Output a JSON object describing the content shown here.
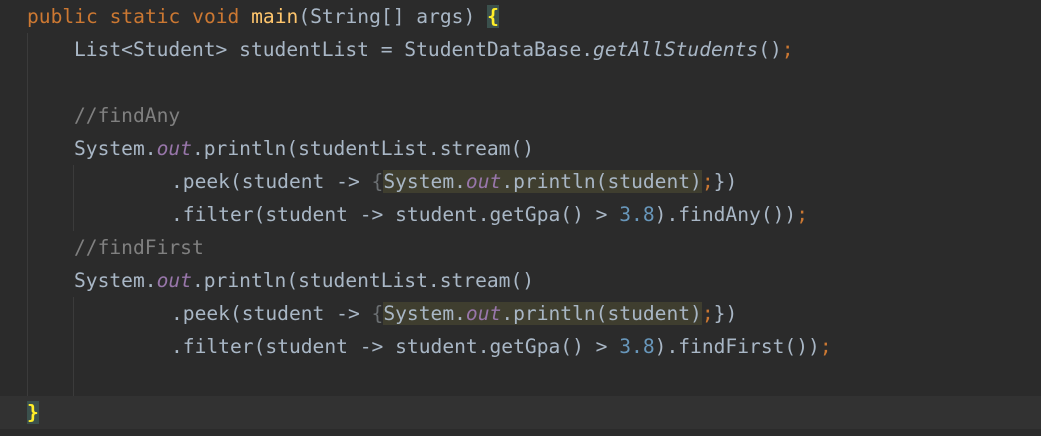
{
  "code": {
    "line1": {
      "kw_public": "public",
      "sp1": " ",
      "kw_static": "static",
      "sp2": " ",
      "kw_void": "void",
      "sp3": " ",
      "method": "main",
      "params": "(String[] args) ",
      "brace_open": "{"
    },
    "line2": {
      "pre": "List<Student> studentList = StudentDataBase.",
      "call": "getAllStudents",
      "post": "()",
      "semi": ";"
    },
    "line4": {
      "comment": "//findAny"
    },
    "line5": {
      "pre": "System.",
      "field": "out",
      "post": ".println(studentList.stream()"
    },
    "line6": {
      "pre": ".peek(student -> ",
      "brace_open": "{",
      "hl_pre": "System.",
      "hl_field": "out",
      "hl_post": ".println(student)",
      "semi": ";",
      "close": "})"
    },
    "line7": {
      "pre": ".filter(student -> student.getGpa() > ",
      "num": "3.8",
      "post": ").findAny())",
      "semi": ";"
    },
    "line8": {
      "comment": "//findFirst"
    },
    "line9": {
      "pre": "System.",
      "field": "out",
      "post": ".println(studentList.stream()"
    },
    "line10": {
      "pre": ".peek(student -> ",
      "brace_open": "{",
      "hl_pre": "System.",
      "hl_field": "out",
      "hl_post": ".println(student)",
      "semi": ";",
      "close": "})"
    },
    "line11": {
      "pre": ".filter(student -> student.getGpa() > ",
      "num": "3.8",
      "post": ").findFirst())",
      "semi": ";"
    },
    "line13": {
      "brace_close": "}"
    }
  },
  "colors": {
    "background": "#2b2b2b",
    "current_line": "#323232",
    "keyword": "#cc7832",
    "method": "#ffc66d",
    "number": "#6897bb",
    "comment": "#808080",
    "static_field": "#9876aa",
    "default_text": "#a9b7c6",
    "brace_match": "#ffef28"
  }
}
